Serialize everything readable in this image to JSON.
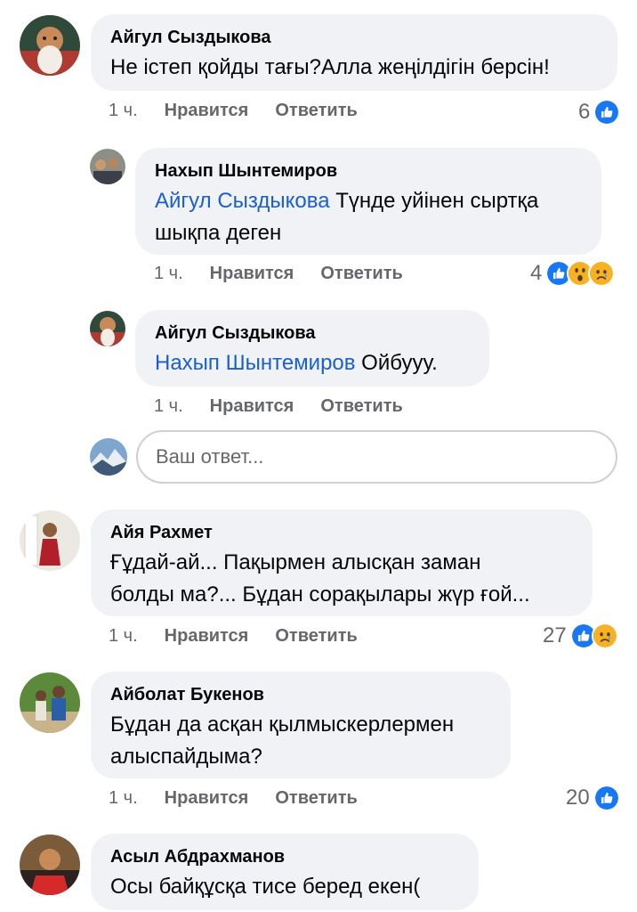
{
  "comments": [
    {
      "author": "Айгул Сыздыкова",
      "text": "Не істеп қойды тағы?Алла жеңілдігін берсін!",
      "time": "1 ч.",
      "like": "Нравится",
      "reply": "Ответить",
      "reactions": "6"
    },
    {
      "author": "Нахып Шынтемиров",
      "mention": "Айгул Сыздыкова",
      "text_1": " Түнде уйінен сыртқа",
      "text_2": "шықпа деген",
      "time": "1 ч.",
      "like": "Нравится",
      "reply": "Ответить",
      "reactions": "4"
    },
    {
      "author": "Айгул Сыздыкова",
      "mention": "Нахып Шынтемиров",
      "text": " Ойбууу.",
      "time": "1 ч.",
      "like": "Нравится",
      "reply": "Ответить"
    },
    {
      "author": "Айя Рахмет",
      "text_1": "Ғұдай-ай... Пақырмен алысқан заман",
      "text_2": "болды ма?... Бұдан сорақылары жүр ғой...",
      "time": "1 ч.",
      "like": "Нравится",
      "reply": "Ответить",
      "reactions": "27"
    },
    {
      "author": "Айболат Букенов",
      "text_1": "Бұдан да асқан қылмыскерлермен",
      "text_2": "алыспайдыма?",
      "time": "1 ч.",
      "like": "Нравится",
      "reply": "Ответить",
      "reactions": "20"
    },
    {
      "author": "Асыл Абдрахманов",
      "text": "Осы байқұсқа тисе беред екен("
    }
  ],
  "reply_box": {
    "placeholder": "Ваш ответ..."
  },
  "colors": {
    "bubble": "#f0f2f5",
    "mention": "#1a5fd0",
    "meta": "#65676b",
    "like": "#1877f2"
  }
}
